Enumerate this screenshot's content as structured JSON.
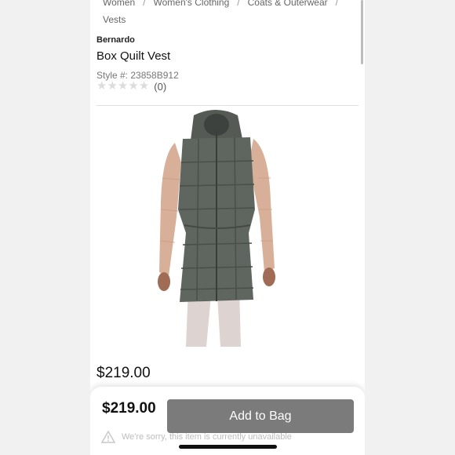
{
  "breadcrumb": {
    "items": [
      "Women",
      "Women's Clothing",
      "Coats & Outerwear",
      "Vests"
    ],
    "separator": "/"
  },
  "product": {
    "brand": "Bernardo",
    "title": "Box Quilt Vest",
    "style_label": "Style #: 23858B912",
    "rating_stars": 0,
    "review_count": "(0)",
    "price": "$219.00",
    "image_icon": "vest-photo"
  },
  "bottom_bar": {
    "price": "$219.00",
    "add_to_bag_label": "Add to Bag",
    "warning_text": "We're sorry, this item is currently unavailable",
    "warning_icon": "warning-triangle-icon"
  },
  "colors": {
    "vest": "#5f655f",
    "sleeves": "#d8b09a",
    "pants": "#ddd3d1",
    "button": "#7b7b7b"
  }
}
